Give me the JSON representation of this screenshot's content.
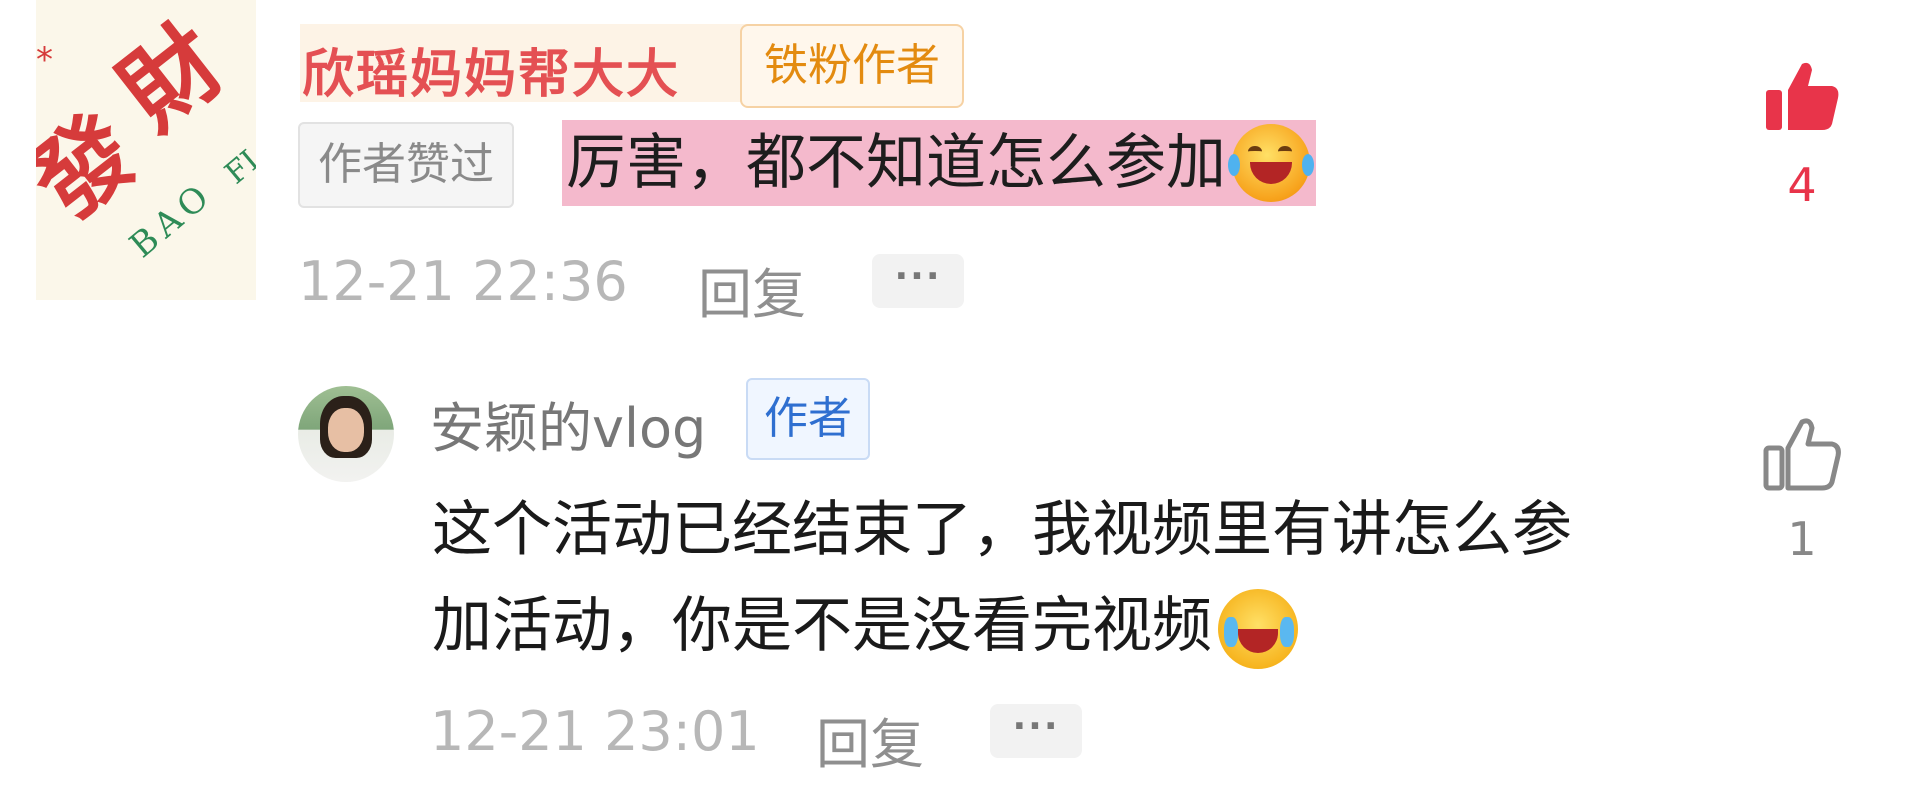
{
  "comment": {
    "avatar": {
      "text_line1": "發",
      "text_line2": "財",
      "subtext": "BAO",
      "subtext2": "FI",
      "star": "*"
    },
    "username": "欣瑶妈妈帮大大",
    "fan_badge": "铁粉作者",
    "liked_badge": "作者赞过",
    "text": "厉害，都不知道怎么参加",
    "emoji": "laughing-tears-emoji",
    "timestamp": "12-21 22:36",
    "reply_label": "回复",
    "more_label": "···",
    "likes": "4",
    "liked": true,
    "like_color": "#e8344a"
  },
  "reply": {
    "username": "安颖的vlog",
    "author_badge": "作者",
    "text": "这个活动已经结束了，我视频里有讲怎么参加活动，你是不是没看完视频",
    "emoji": "crying-face-emoji",
    "timestamp": "12-21 23:01",
    "reply_label": "回复",
    "more_label": "···",
    "likes": "1",
    "liked": false,
    "like_color": "#888888"
  },
  "colors": {
    "highlight": "#f4b9cc",
    "author_badge_blue": "#2f6fd0",
    "fan_badge_orange": "#e38b10"
  }
}
